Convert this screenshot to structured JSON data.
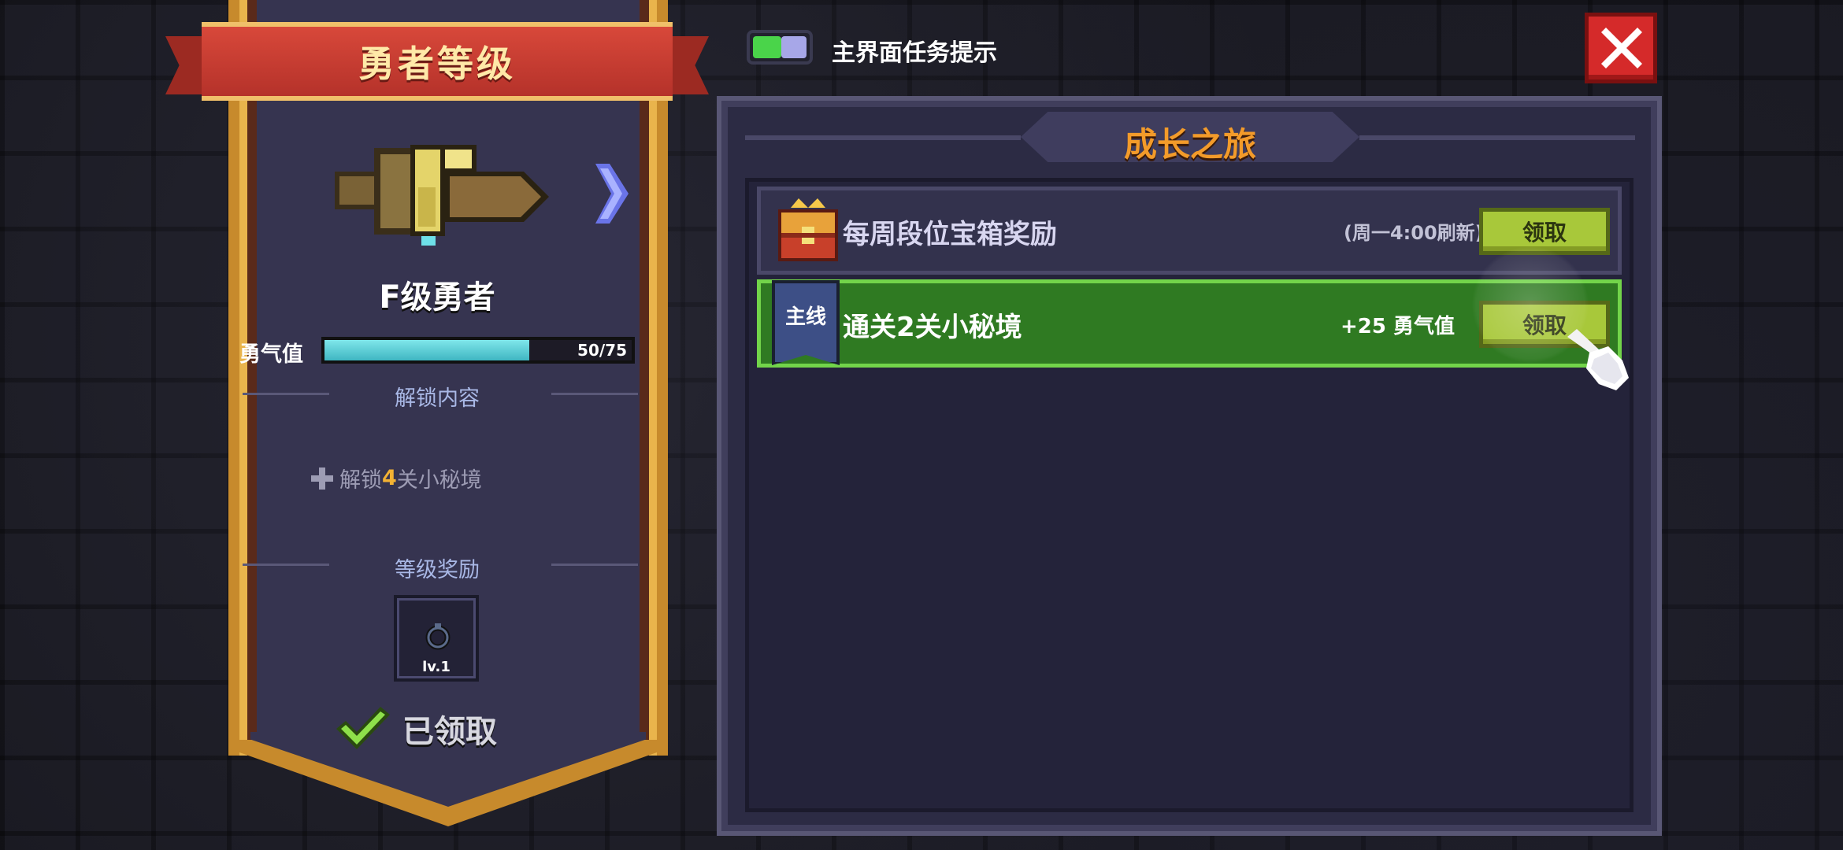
{
  "left_panel": {
    "banner_title": "勇者等级",
    "rank_title": "F级勇者",
    "exp": {
      "label": "勇气值",
      "current": 50,
      "max": 75,
      "text": "50/75"
    },
    "unlock_section": "解锁内容",
    "unlock_item": {
      "prefix": "解锁",
      "number": "4",
      "suffix": "关小秘境"
    },
    "reward_section": "等级奖励",
    "reward_slot": {
      "level": "lv.1",
      "icon": "ring-icon"
    },
    "claimed_label": "已领取"
  },
  "top_bar": {
    "toggle_on": true,
    "toggle_label": "主界面任务提示"
  },
  "panel": {
    "title": "成长之旅",
    "tasks": [
      {
        "icon": "treasure-chest-icon",
        "title": "每周段位宝箱奖励",
        "note": "(周一4:00刷新)",
        "button": "领取"
      },
      {
        "badge": "主线",
        "title": "通关2关小秘境",
        "note": "+25 勇气值",
        "button": "领取",
        "highlighted": true
      }
    ]
  },
  "colors": {
    "accent_orange": "#f39b2a",
    "claim_green": "#a8c83a",
    "highlight_green": "#2f7a22",
    "exp_cyan": "#5fd0d8",
    "close_red": "#d52a2a"
  }
}
